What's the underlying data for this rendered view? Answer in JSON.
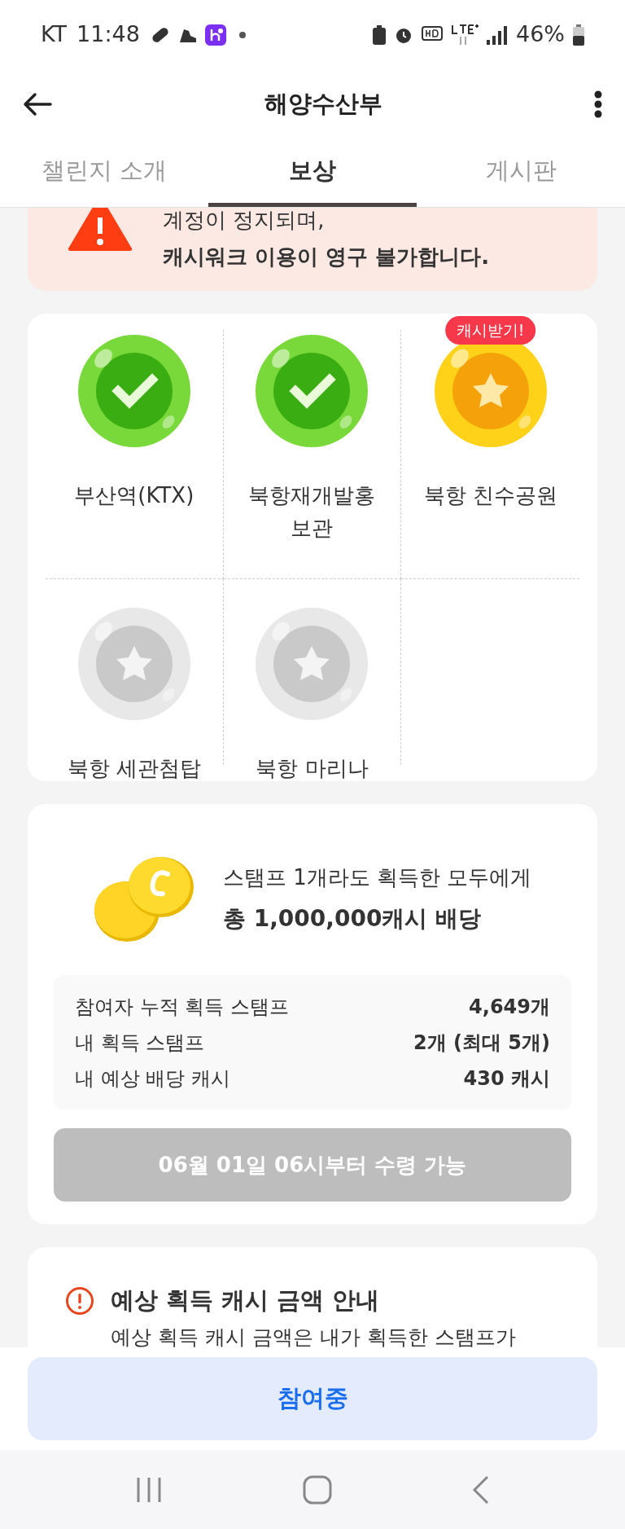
{
  "status_bar": {
    "carrier": "KT",
    "time": "11:48",
    "battery": "46%"
  },
  "header": {
    "title": "해양수산부"
  },
  "tabs": [
    {
      "label": "챌린지 소개",
      "selected": false
    },
    {
      "label": "보상",
      "selected": true
    },
    {
      "label": "게시판",
      "selected": false
    }
  ],
  "warning": {
    "lines": [
      {
        "text": "계정이 정지되며,",
        "emphasis": false
      },
      {
        "text": "캐시워크 이용이 영구 불가합니다.",
        "emphasis": true
      }
    ]
  },
  "stamps": [
    {
      "label": "부산역(KTX)",
      "kind": "done"
    },
    {
      "label": "북항재개발홍보관",
      "kind": "done"
    },
    {
      "label": "북항 친수공원",
      "kind": "ready",
      "badge": "캐시받기!"
    },
    {
      "label": "북항 세관첨탑",
      "kind": "locked"
    },
    {
      "label": "북항 마리나",
      "kind": "locked"
    }
  ],
  "reward": {
    "headline": "스탬프 1개라도 획득한 모두에게",
    "total": "총 1,000,000캐시 배당",
    "stats": [
      {
        "label": "참여자 누적 획득 스탬프",
        "value": "4,649개"
      },
      {
        "label": "내 획득 스탬프",
        "value": "2개 (최대 5개)"
      },
      {
        "label": "내 예상 배당 캐시",
        "value": "430 캐시"
      }
    ],
    "claim_button": {
      "label": "06월 01일 06시부터 수령 가능",
      "disabled": true
    }
  },
  "notice": {
    "title": "예상 획득 캐시 금액 안내",
    "text": "예상 획득 캐시 금액은 내가 획득한 스탬프가"
  },
  "bottom_button": {
    "label": "참여중"
  }
}
